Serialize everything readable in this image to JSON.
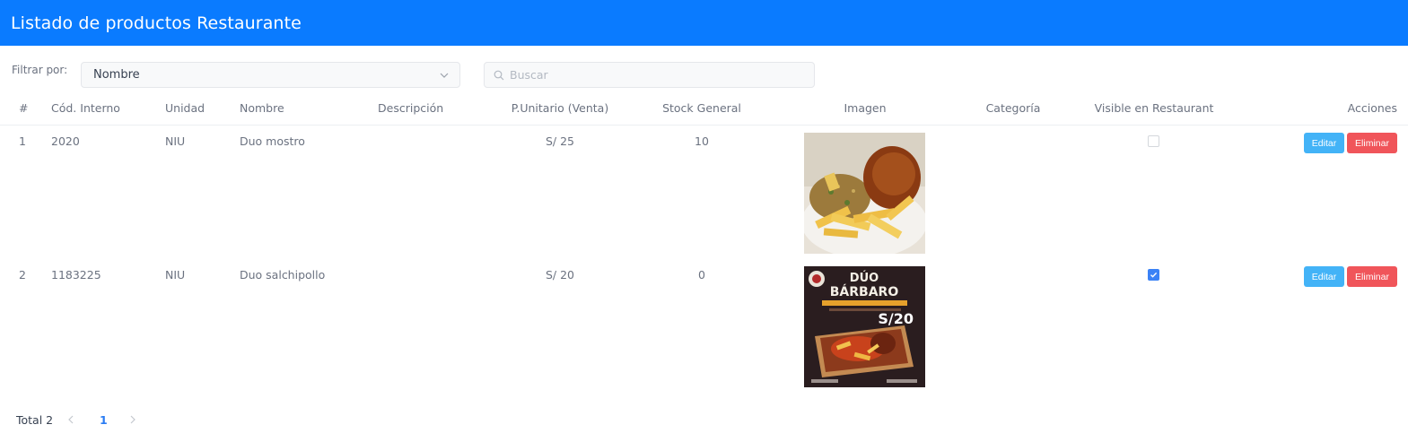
{
  "header": {
    "title": "Listado de productos Restaurante"
  },
  "filters": {
    "label": "Filtrar por:",
    "select_value": "Nombre",
    "search_placeholder": "Buscar"
  },
  "table": {
    "columns": [
      "#",
      "Cód. Interno",
      "Unidad",
      "Nombre",
      "Descripción",
      "P.Unitario (Venta)",
      "Stock General",
      "Imagen",
      "Categoría",
      "Visible en Restaurant",
      "Acciones"
    ],
    "rows": [
      {
        "num": "1",
        "code": "2020",
        "unit": "NIU",
        "name": "Duo mostro",
        "description": "",
        "price": "S/ 25",
        "stock": "10",
        "category": "",
        "visible": false,
        "image": "fried-rice-chicken-fries-photo",
        "edit": "Editar",
        "delete": "Eliminar"
      },
      {
        "num": "2",
        "code": "1183225",
        "unit": "NIU",
        "name": "Duo salchipollo",
        "description": "",
        "price": "S/ 20",
        "stock": "0",
        "category": "",
        "visible": true,
        "image": "duo-barbaro-promo-poster",
        "edit": "Editar",
        "delete": "Eliminar",
        "poster": {
          "brand": "DÚO",
          "title": "BÁRBARO",
          "price": "S/20"
        }
      }
    ]
  },
  "pagination": {
    "total_label": "Total 2",
    "current_page": "1"
  },
  "colors": {
    "header_bg": "#0a7bff",
    "edit_btn": "#43b3f7",
    "delete_btn": "#f0555a",
    "checkbox_on": "#3b82f6"
  }
}
